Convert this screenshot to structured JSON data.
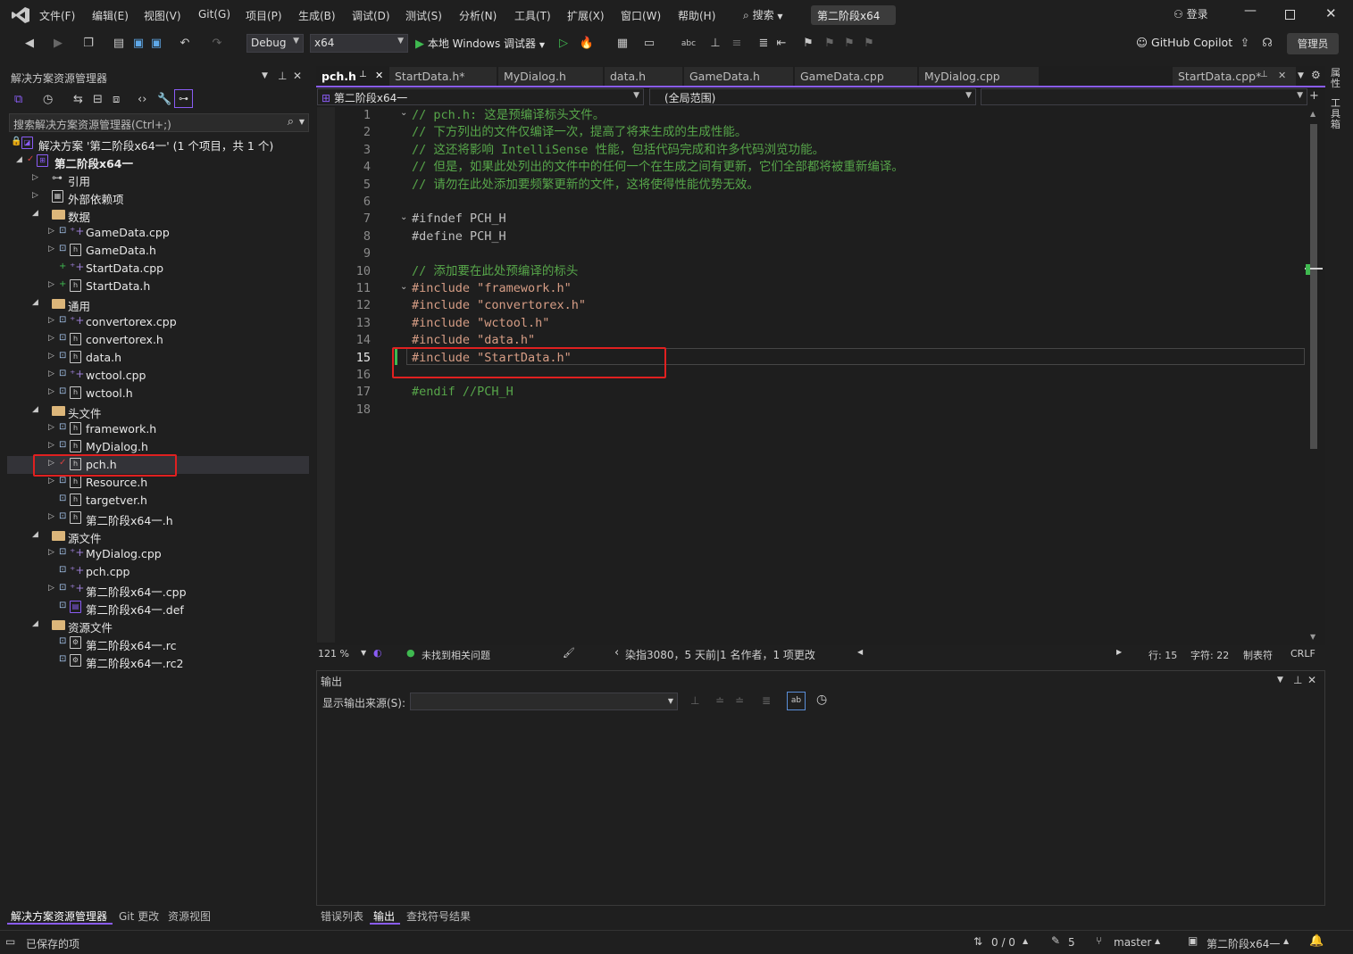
{
  "menu": {
    "items": [
      "文件(F)",
      "编辑(E)",
      "视图(V)",
      "Git(G)",
      "项目(P)",
      "生成(B)",
      "调试(D)",
      "测试(S)",
      "分析(N)",
      "工具(T)",
      "扩展(X)",
      "窗口(W)",
      "帮助(H)"
    ],
    "search_label": "搜索",
    "solution_name_badge": "第二阶段x64一",
    "login_label": "登录"
  },
  "toolbar": {
    "config": "Debug",
    "platform": "x64",
    "run_label": "本地 Windows 调试器",
    "copilot_label": "GitHub Copilot",
    "admin_label": "管理员"
  },
  "solution_explorer": {
    "title": "解决方案资源管理器",
    "search_placeholder": "搜索解决方案资源管理器(Ctrl+;)",
    "solution_label": "解决方案 '第二阶段x64一' (1 个项目，共 1 个)",
    "project_label": "第二阶段x64一",
    "rows": [
      {
        "label": "引用",
        "kind": "ref"
      },
      {
        "label": "外部依赖项",
        "kind": "ext"
      },
      {
        "label": "数据",
        "kind": "folder"
      },
      {
        "label": "GameData.cpp",
        "kind": "cpp"
      },
      {
        "label": "GameData.h",
        "kind": "h"
      },
      {
        "label": "StartData.cpp",
        "kind": "cpp"
      },
      {
        "label": "StartData.h",
        "kind": "h"
      },
      {
        "label": "通用",
        "kind": "folder"
      },
      {
        "label": "convertorex.cpp",
        "kind": "cpp"
      },
      {
        "label": "convertorex.h",
        "kind": "h"
      },
      {
        "label": "data.h",
        "kind": "h"
      },
      {
        "label": "wctool.cpp",
        "kind": "cpp"
      },
      {
        "label": "wctool.h",
        "kind": "h"
      },
      {
        "label": "头文件",
        "kind": "folder"
      },
      {
        "label": "framework.h",
        "kind": "h"
      },
      {
        "label": "MyDialog.h",
        "kind": "h"
      },
      {
        "label": "pch.h",
        "kind": "h"
      },
      {
        "label": "Resource.h",
        "kind": "h"
      },
      {
        "label": "targetver.h",
        "kind": "h"
      },
      {
        "label": "第二阶段x64一.h",
        "kind": "h"
      },
      {
        "label": "源文件",
        "kind": "folder"
      },
      {
        "label": "MyDialog.cpp",
        "kind": "cpp"
      },
      {
        "label": "pch.cpp",
        "kind": "cpp"
      },
      {
        "label": "第二阶段x64一.cpp",
        "kind": "cpp"
      },
      {
        "label": "第二阶段x64一.def",
        "kind": "def"
      },
      {
        "label": "资源文件",
        "kind": "folder"
      },
      {
        "label": "第二阶段x64一.rc",
        "kind": "rc"
      },
      {
        "label": "第二阶段x64一.rc2",
        "kind": "rc"
      }
    ]
  },
  "editor": {
    "tabs": [
      "pch.h",
      "StartData.h*",
      "MyDialog.h",
      "data.h",
      "GameData.h",
      "GameData.cpp",
      "MyDialog.cpp"
    ],
    "pinned_tab": "StartData.cpp*",
    "scope_left": "第二阶段x64一",
    "scope_right": "(全局范围)",
    "lines": [
      "// pch.h: 这是预编译标头文件。",
      "// 下方列出的文件仅编译一次，提高了将来生成的生成性能。",
      "// 这还将影响 IntelliSense 性能，包括代码完成和许多代码浏览功能。",
      "// 但是，如果此处列出的文件中的任何一个在生成之间有更新，它们全部都将被重新编译。",
      "// 请勿在此处添加要频繁更新的文件，这将使得性能优势无效。",
      "",
      "#ifndef PCH_H",
      "#define PCH_H",
      "",
      "// 添加要在此处预编译的标头",
      "#include \"framework.h\"",
      "#include \"convertorex.h\"",
      "#include \"wctool.h\"",
      "#include \"data.h\"",
      "#include \"StartData.h\"",
      "",
      "#endif //PCH_H",
      ""
    ],
    "line_numbers": [
      "1",
      "2",
      "3",
      "4",
      "5",
      "6",
      "7",
      "8",
      "9",
      "10",
      "11",
      "12",
      "13",
      "14",
      "15",
      "16",
      "17",
      "18"
    ]
  },
  "editor_status": {
    "zoom": "121 %",
    "issues": "未找到相关问题",
    "blame": "染指3080，5 天前|1 名作者，1 项更改",
    "line": "行: 15",
    "col": "字符: 22",
    "tabs": "制表符",
    "eol": "CRLF"
  },
  "output": {
    "title": "输出",
    "source_label": "显示输出来源(S):"
  },
  "bottom_tabs_left": [
    "解决方案资源管理器",
    "Git 更改",
    "资源视图"
  ],
  "bottom_tabs_right": [
    "错误列表",
    "输出",
    "查找符号结果"
  ],
  "right_rail": [
    "属性",
    "工具箱"
  ],
  "statusbar": {
    "saved": "已保存的项",
    "sync": "0 / 0",
    "edits": "5",
    "branch": "master",
    "project": "第二阶段x64一"
  },
  "colors": {
    "accent": "#8a5cf5",
    "highlight_box": "#e02020",
    "comment": "#57a64a",
    "string": "#d69d85"
  }
}
